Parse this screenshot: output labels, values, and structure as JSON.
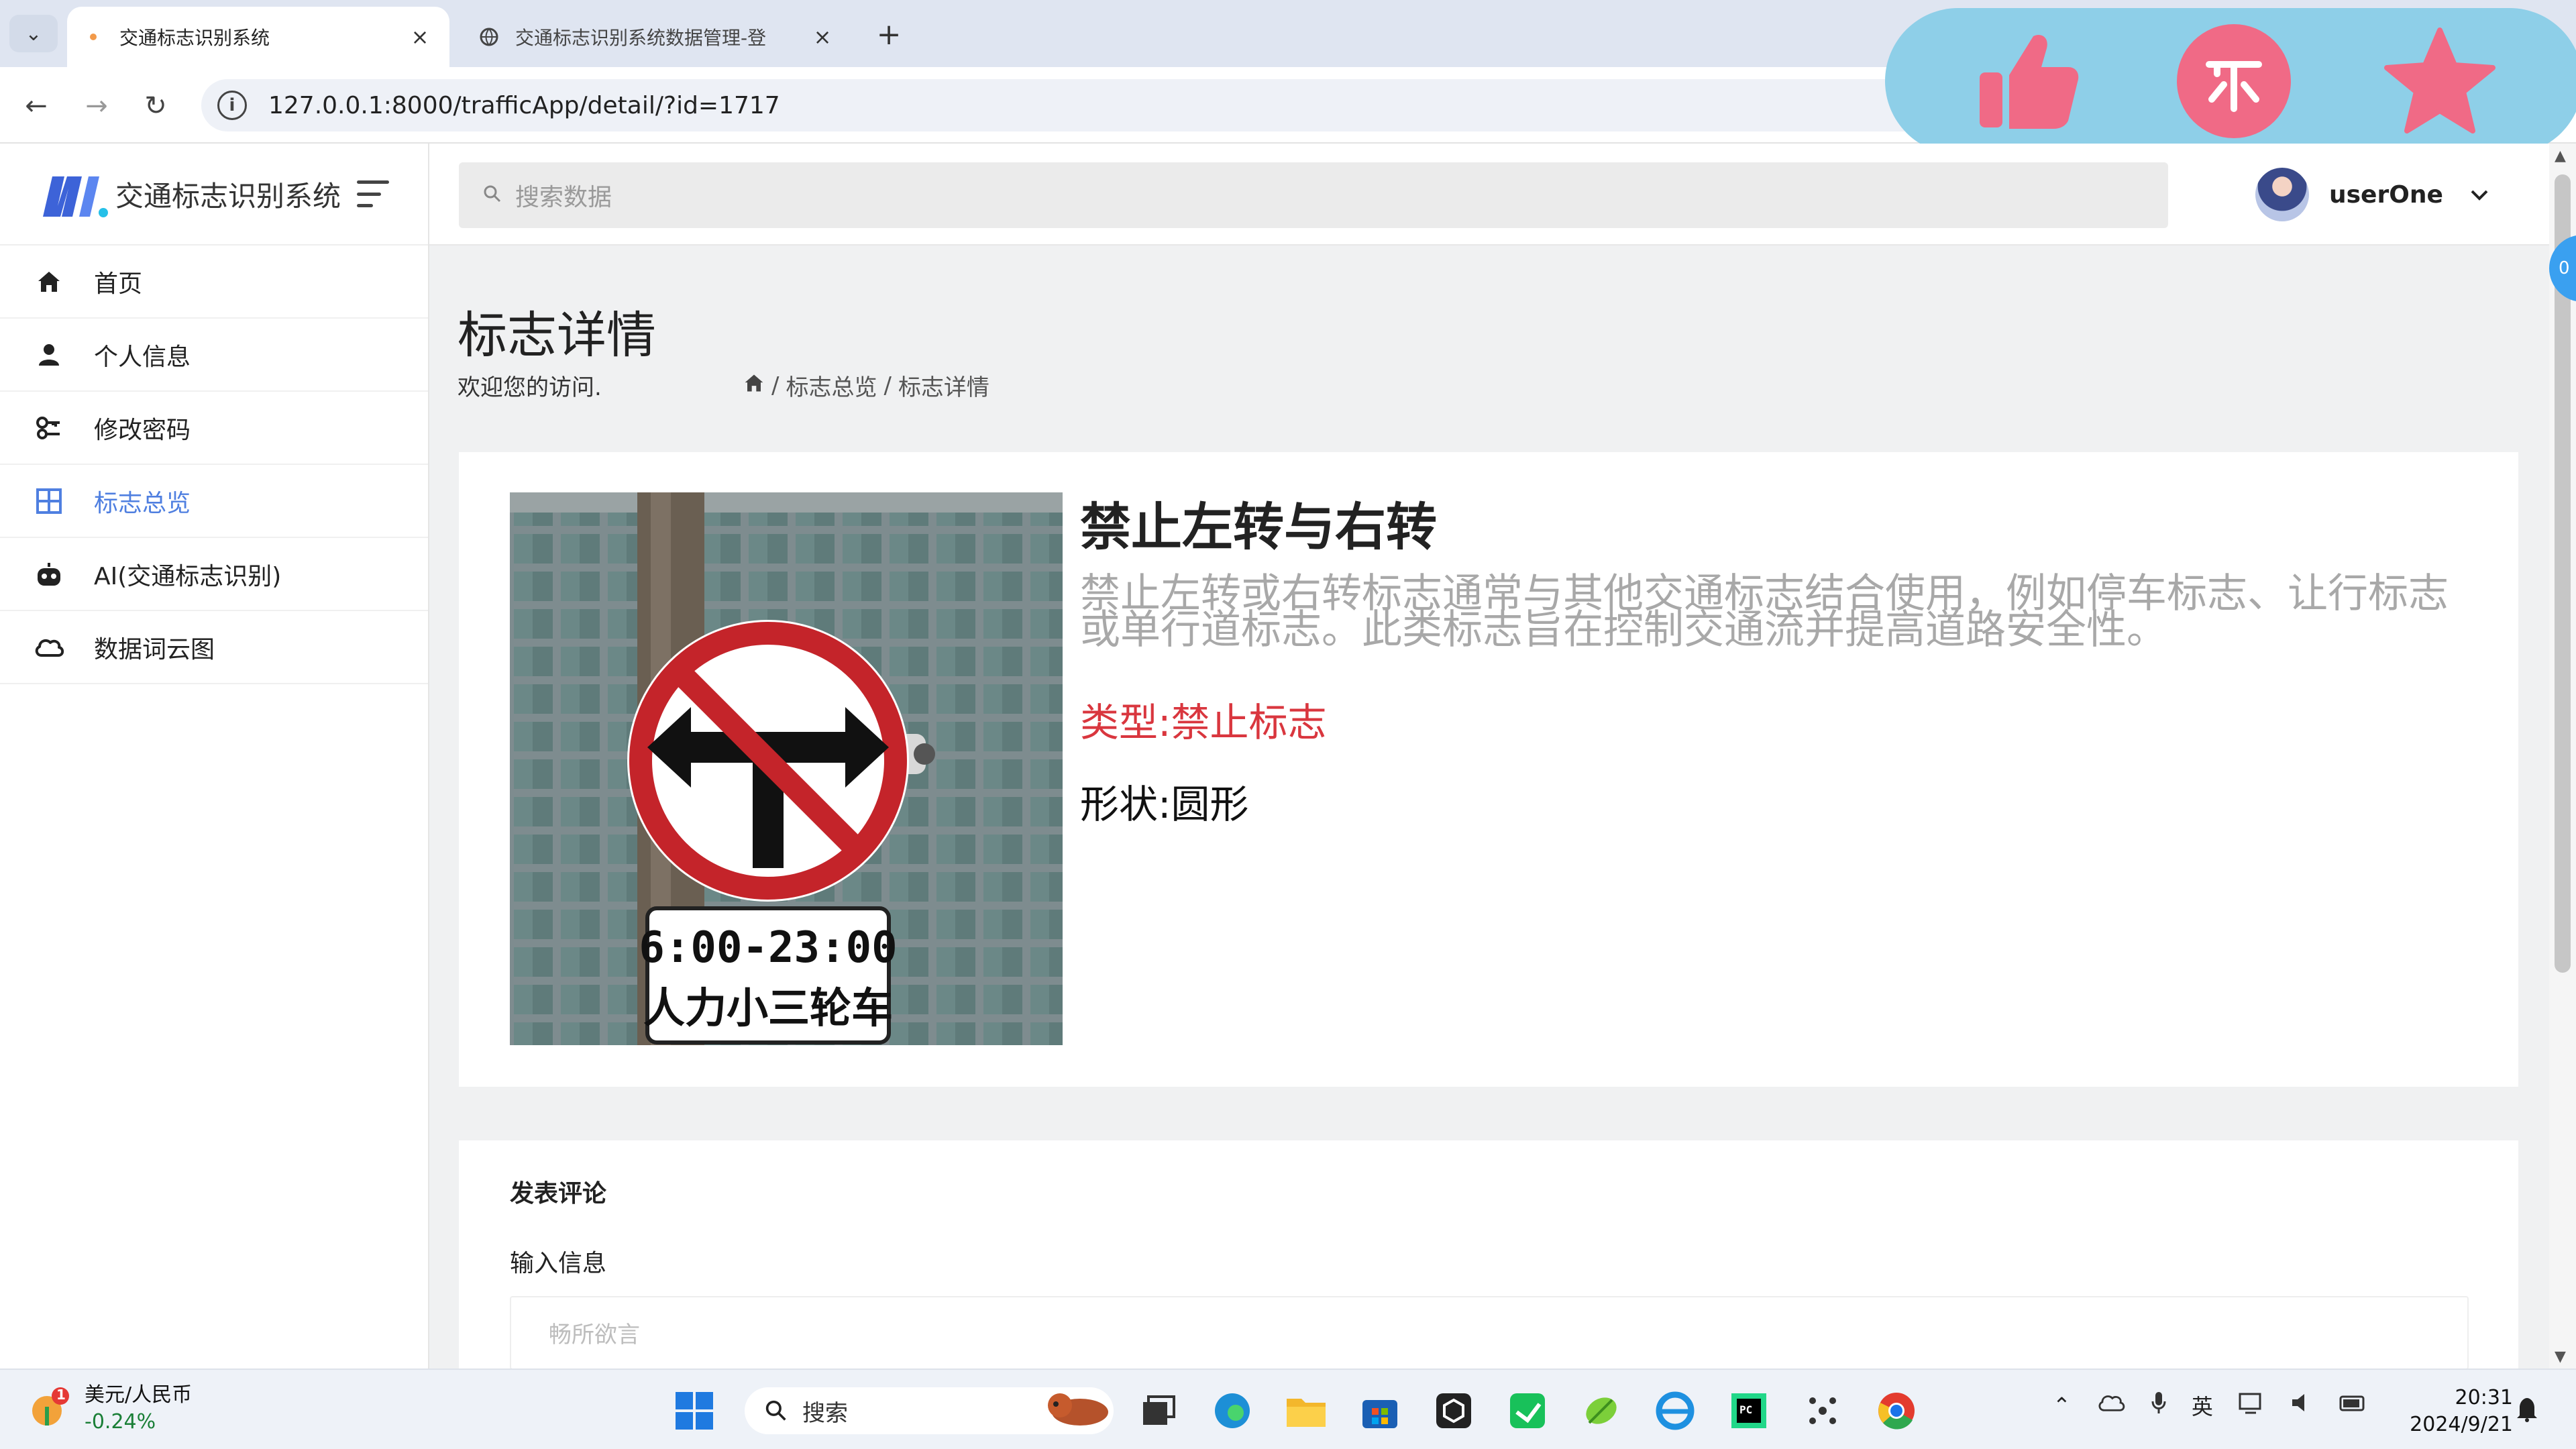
{
  "browser": {
    "tabs": [
      {
        "label": "交通标志识别系统",
        "active": true
      },
      {
        "label": "交通标志识别系统数据管理-登",
        "active": false
      }
    ],
    "new_tab": "+",
    "url": "127.0.0.1:8000/trafficApp/detail/?id=1717"
  },
  "sidebar": {
    "brand": "交通标志识别系统",
    "items": [
      {
        "label": "首页",
        "icon": "home-icon",
        "active": false
      },
      {
        "label": "个人信息",
        "icon": "user-icon",
        "active": false
      },
      {
        "label": "修改密码",
        "icon": "key-icon",
        "active": false
      },
      {
        "label": "标志总览",
        "icon": "grid-icon",
        "active": true
      },
      {
        "label": "AI(交通标志识别)",
        "icon": "robot-icon",
        "active": false
      },
      {
        "label": "数据词云图",
        "icon": "cloud-icon",
        "active": false
      }
    ]
  },
  "header": {
    "search_placeholder": "搜索数据",
    "username": "userOne"
  },
  "page": {
    "title": "标志详情",
    "welcome": "欢迎您的访问.",
    "breadcrumb": [
      "标志总览",
      "标志详情"
    ],
    "breadcrumb_sep": "/"
  },
  "sign": {
    "name": "禁止左转与右转",
    "description": "禁止左转或右转标志通常与其他交通标志结合使用，例如停车标志、让行标志或单行道标志。此类标志旨在控制交通流并提高道路安全性。",
    "type": "类型:禁止标志",
    "shape": "形状:圆形",
    "image_text": [
      "6:00-23:00",
      "人力小三轮车"
    ]
  },
  "comment": {
    "title": "发表评论",
    "label": "输入信息",
    "placeholder": "畅所欲言"
  },
  "scroll_badge": "0",
  "taskbar": {
    "widget_title": "美元/人民币",
    "widget_value": "-0.24%",
    "widget_badge": "1",
    "search": "搜索",
    "ime": "英",
    "time": "20:31",
    "date": "2024/9/21"
  },
  "colors": {
    "accent": "#4f7fe0",
    "type_text": "#d9363e",
    "react_bar": "#8ecfe8",
    "react_red": "#f06a86"
  }
}
